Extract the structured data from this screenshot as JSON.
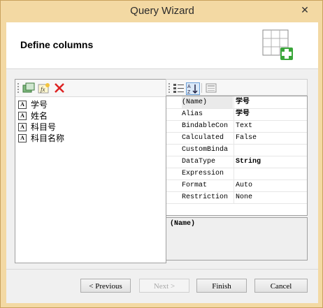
{
  "window": {
    "title": "Query Wizard"
  },
  "header": {
    "title": "Define columns",
    "icon": "table-add-icon"
  },
  "left_toolbar": {
    "buttons": [
      {
        "icon": "add-column-icon"
      },
      {
        "icon": "add-expression-icon"
      },
      {
        "icon": "delete-icon"
      }
    ]
  },
  "columns": [
    {
      "label": "学号"
    },
    {
      "label": "姓名"
    },
    {
      "label": "科目号"
    },
    {
      "label": "科目名称"
    }
  ],
  "property_toolbar": {
    "buttons": [
      {
        "icon": "categorized-icon"
      },
      {
        "icon": "alphabetical-sort-icon"
      },
      {
        "icon": "property-pages-icon"
      }
    ]
  },
  "properties": [
    {
      "name": "(Name)",
      "value": "学号"
    },
    {
      "name": "Alias",
      "value": "学号"
    },
    {
      "name": "BindableCon",
      "value": "Text"
    },
    {
      "name": "Calculated",
      "value": "False"
    },
    {
      "name": "CustomBinda",
      "value": ""
    },
    {
      "name": "DataType",
      "value": "String"
    },
    {
      "name": "Expression",
      "value": ""
    },
    {
      "name": "Format",
      "value": "Auto"
    },
    {
      "name": "Restriction",
      "value": "None"
    }
  ],
  "description": {
    "title": "(Name)"
  },
  "buttons": {
    "previous": "< Previous",
    "next": "Next >",
    "finish": "Finish",
    "cancel": "Cancel"
  }
}
